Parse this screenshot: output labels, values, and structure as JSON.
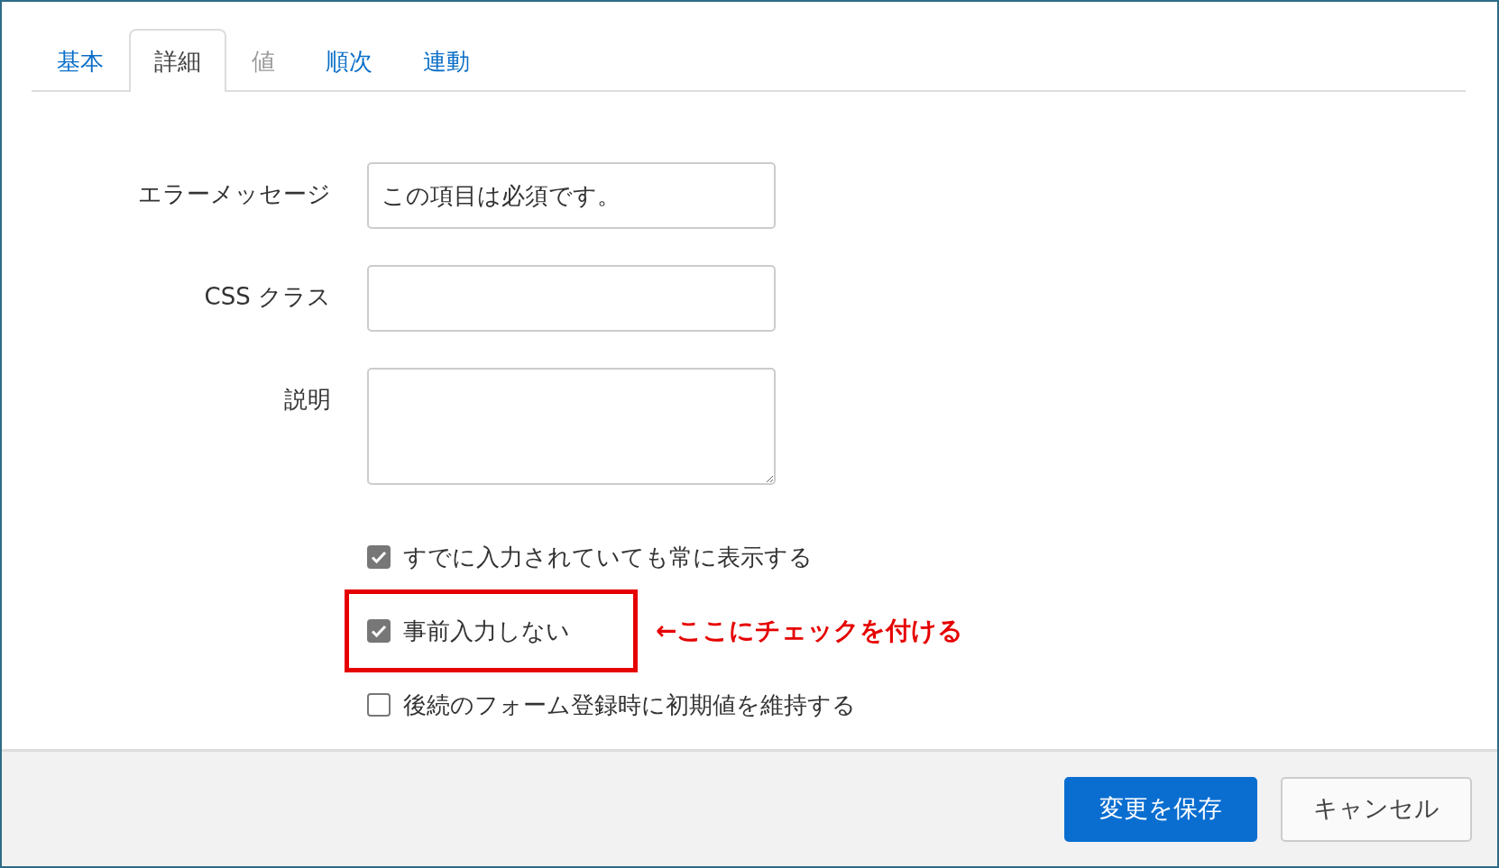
{
  "tabs": [
    {
      "label": "基本",
      "selected": false,
      "disabled": false
    },
    {
      "label": "詳細",
      "selected": true,
      "disabled": false
    },
    {
      "label": "値",
      "selected": false,
      "disabled": true
    },
    {
      "label": "順次",
      "selected": false,
      "disabled": false
    },
    {
      "label": "連動",
      "selected": false,
      "disabled": false
    }
  ],
  "fields": [
    {
      "label": "エラーメッセージ",
      "kind": "input",
      "value": "この項目は必須です。"
    },
    {
      "label": "CSS クラス",
      "kind": "input"
    },
    {
      "label": "説明",
      "kind": "textarea"
    }
  ],
  "options": [
    {
      "label": "すでに入力されていても常に表示する",
      "checked": true,
      "highlighted": false
    },
    {
      "label": "事前入力しない",
      "checked": true,
      "highlighted": true,
      "annotation": "←ここにチェックを付ける"
    },
    {
      "label": "後続のフォーム登録時に初期値を維持する",
      "checked": false,
      "highlighted": false
    }
  ],
  "buttons": [
    {
      "label": "変更を保存",
      "kind": "primary"
    },
    {
      "label": "キャンセル",
      "kind": "secondary"
    }
  ]
}
